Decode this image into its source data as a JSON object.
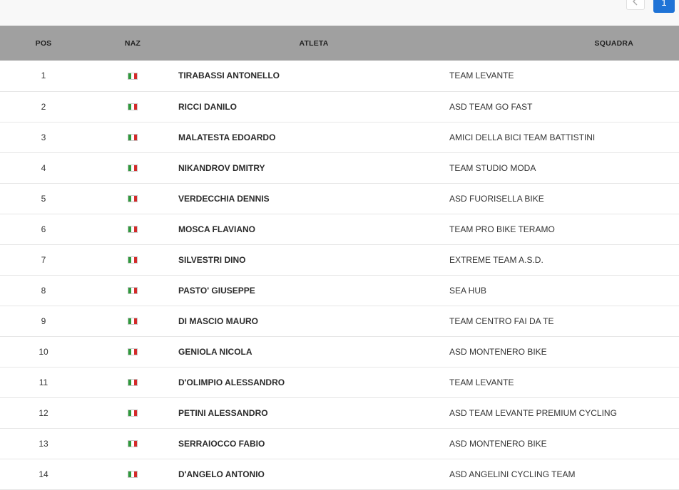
{
  "pagination": {
    "prev_icon": "chevron-left-icon",
    "current_page": "1"
  },
  "table": {
    "headers": {
      "pos": "POS",
      "naz": "NAZ",
      "atleta": "ATLETA",
      "squadra": "SQUADRA"
    },
    "rows": [
      {
        "pos": "1",
        "naz": "italy-flag-icon",
        "atleta": "TIRABASSI ANTONELLO",
        "squadra": "TEAM LEVANTE"
      },
      {
        "pos": "2",
        "naz": "italy-flag-icon",
        "atleta": "RICCI DANILO",
        "squadra": "ASD TEAM GO FAST"
      },
      {
        "pos": "3",
        "naz": "italy-flag-icon",
        "atleta": "MALATESTA EDOARDO",
        "squadra": "AMICI DELLA BICI TEAM BATTISTINI"
      },
      {
        "pos": "4",
        "naz": "italy-flag-icon",
        "atleta": "NIKANDROV DMITRY",
        "squadra": "TEAM STUDIO MODA"
      },
      {
        "pos": "5",
        "naz": "italy-flag-icon",
        "atleta": "VERDECCHIA DENNIS",
        "squadra": "ASD FUORISELLA BIKE"
      },
      {
        "pos": "6",
        "naz": "italy-flag-icon",
        "atleta": "MOSCA FLAVIANO",
        "squadra": "TEAM PRO BIKE TERAMO"
      },
      {
        "pos": "7",
        "naz": "italy-flag-icon",
        "atleta": "SILVESTRI DINO",
        "squadra": "EXTREME TEAM A.S.D."
      },
      {
        "pos": "8",
        "naz": "italy-flag-icon",
        "atleta": "PASTO' GIUSEPPE",
        "squadra": "SEA HUB"
      },
      {
        "pos": "9",
        "naz": "italy-flag-icon",
        "atleta": "DI MASCIO MAURO",
        "squadra": "TEAM CENTRO FAI DA TE"
      },
      {
        "pos": "10",
        "naz": "italy-flag-icon",
        "atleta": "GENIOLA NICOLA",
        "squadra": "ASD MONTENERO BIKE"
      },
      {
        "pos": "11",
        "naz": "italy-flag-icon",
        "atleta": "D'OLIMPIO ALESSANDRO",
        "squadra": "TEAM LEVANTE"
      },
      {
        "pos": "12",
        "naz": "italy-flag-icon",
        "atleta": "PETINI ALESSANDRO",
        "squadra": "ASD TEAM LEVANTE PREMIUM CYCLING"
      },
      {
        "pos": "13",
        "naz": "italy-flag-icon",
        "atleta": "SERRAIOCCO FABIO",
        "squadra": "ASD MONTENERO BIKE"
      },
      {
        "pos": "14",
        "naz": "italy-flag-icon",
        "atleta": "D'ANGELO ANTONIO",
        "squadra": "ASD ANGELINI CYCLING TEAM"
      }
    ]
  },
  "colors": {
    "header_bg": "#a0a0a0",
    "accent": "#1f73d6",
    "row_divider": "#e6e6e6"
  }
}
